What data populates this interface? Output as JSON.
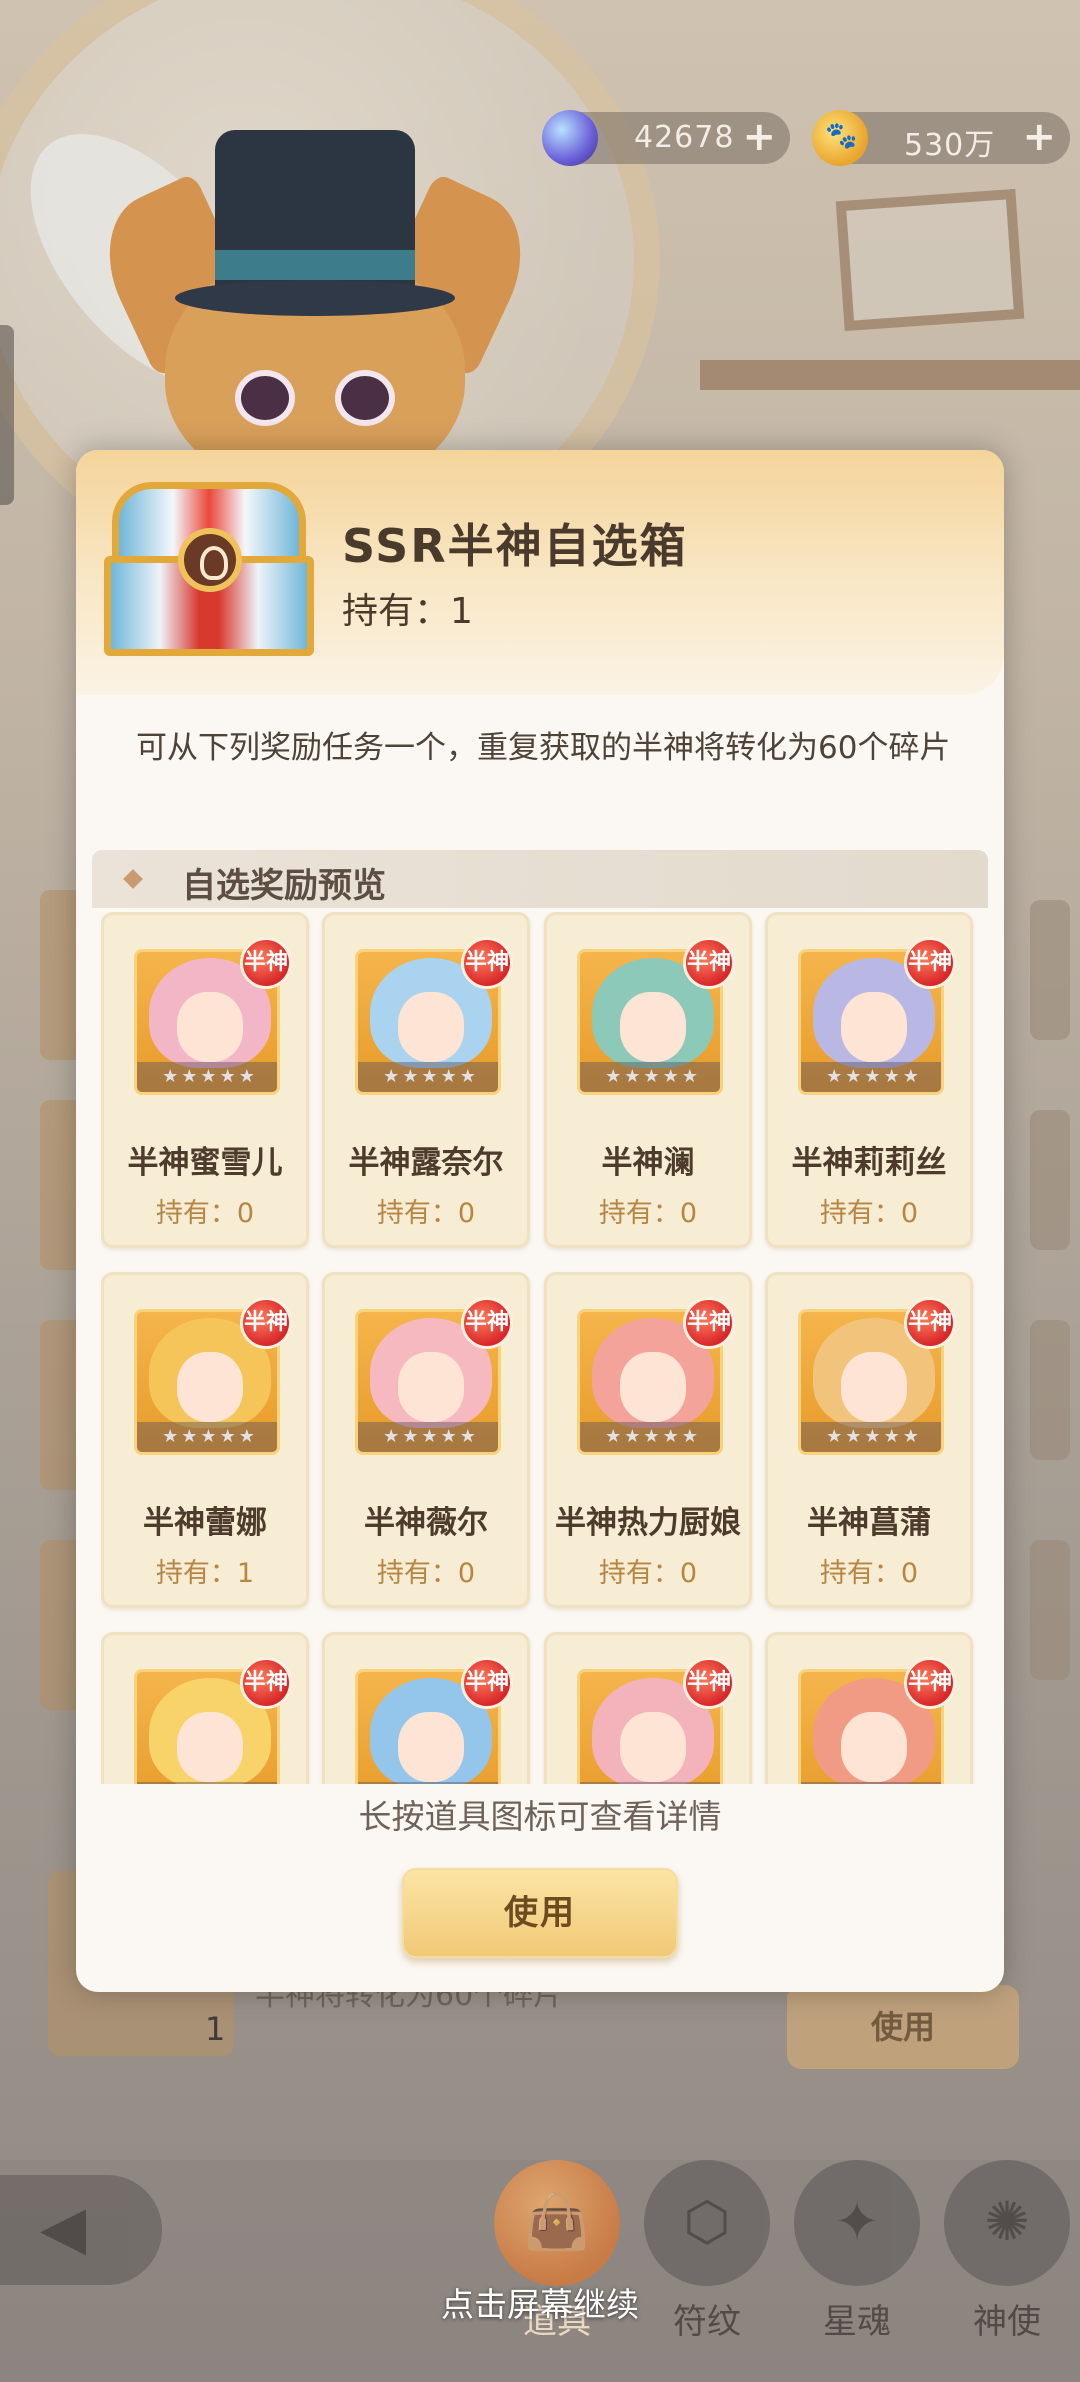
{
  "currencies": {
    "gem": {
      "value": "42678",
      "plus": "+",
      "icon": "gem-icon"
    },
    "coin": {
      "value": "530万",
      "plus": "+",
      "icon": "paw-coin-icon"
    }
  },
  "dialog": {
    "title": "SSR半神自选箱",
    "hold": "持有：1",
    "description": "可从下列奖励任务一个，重复获取的半神将转化为60个碎片",
    "section_title": "自选奖励预览",
    "hint": "长按道具图标可查看详情",
    "use_label": "使用",
    "badge_text": "半神",
    "stars_text": "★★★★★",
    "items": [
      {
        "name": "半神蜜雪儿",
        "hold": "持有：0",
        "hair": "#f3b6c6"
      },
      {
        "name": "半神露奈尔",
        "hold": "持有：0",
        "hair": "#a9d3ee"
      },
      {
        "name": "半神澜",
        "hold": "持有：0",
        "hair": "#8cc9b8"
      },
      {
        "name": "半神莉莉丝",
        "hold": "持有：0",
        "hair": "#b9b8e4"
      },
      {
        "name": "半神蕾娜",
        "hold": "持有：1",
        "hair": "#f6c55a"
      },
      {
        "name": "半神薇尔",
        "hold": "持有：0",
        "hair": "#f6b9c0"
      },
      {
        "name": "半神热力厨娘",
        "hold": "持有：0",
        "hair": "#f3a39a"
      },
      {
        "name": "半神菖蒲",
        "hold": "持有：0",
        "hair": "#f2c37a"
      },
      {
        "name": "",
        "hold": "",
        "hair": "#f8d36a"
      },
      {
        "name": "",
        "hold": "",
        "hair": "#93c6ea"
      },
      {
        "name": "",
        "hold": "",
        "hair": "#f3b3bb"
      },
      {
        "name": "",
        "hold": "",
        "hair": "#f29b84"
      }
    ]
  },
  "background": {
    "item_text": "半神将转化为60个碎片",
    "item_count": "1",
    "use_label": "使用"
  },
  "nav": {
    "items": [
      {
        "label": "道具",
        "icon": "bag-icon",
        "active": true
      },
      {
        "label": "符纹",
        "icon": "rune-icon",
        "active": false
      },
      {
        "label": "星魂",
        "icon": "star-card-icon",
        "active": false
      },
      {
        "label": "神使",
        "icon": "emissary-icon",
        "active": false
      }
    ]
  },
  "continue_hint": "点击屏幕继续"
}
